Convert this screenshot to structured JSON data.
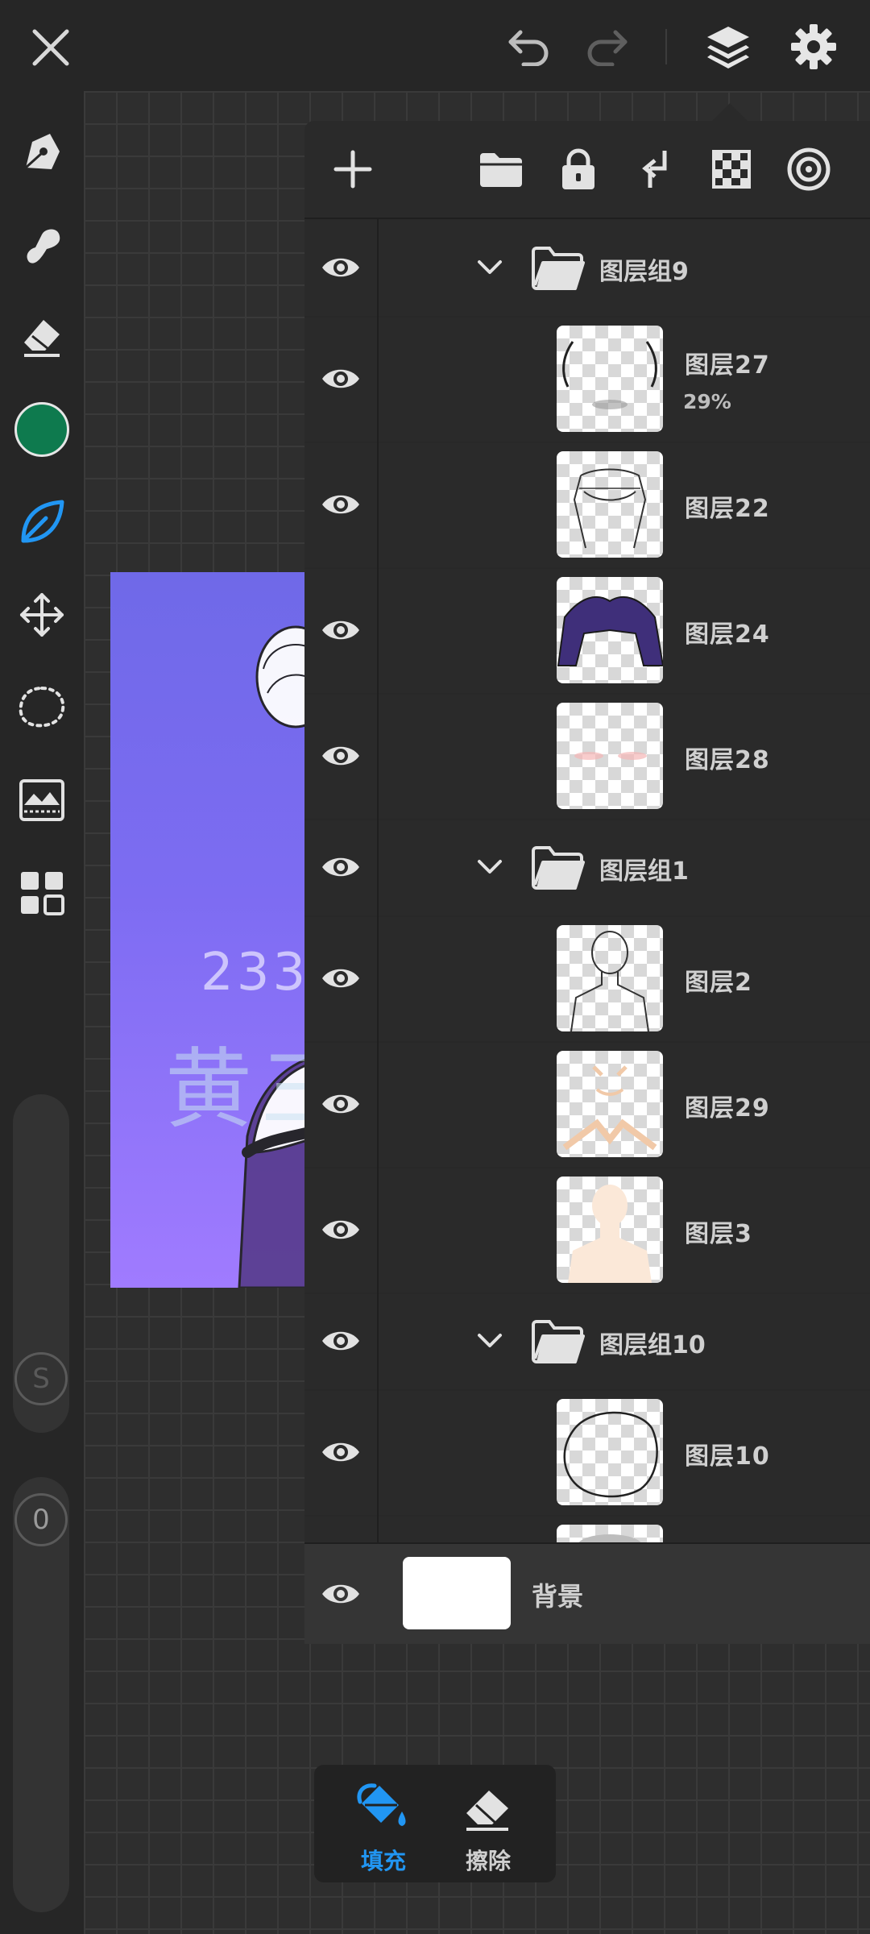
{
  "panel": {
    "layers": [
      {
        "kind": "group",
        "name": "图层组9"
      },
      {
        "kind": "layer",
        "name": "图层27",
        "opacity": "29%"
      },
      {
        "kind": "layer",
        "name": "图层22"
      },
      {
        "kind": "layer",
        "name": "图层24"
      },
      {
        "kind": "layer",
        "name": "图层28"
      },
      {
        "kind": "group",
        "name": "图层组1"
      },
      {
        "kind": "layer",
        "name": "图层2"
      },
      {
        "kind": "layer",
        "name": "图层29"
      },
      {
        "kind": "layer",
        "name": "图层3"
      },
      {
        "kind": "group",
        "name": "图层组10"
      },
      {
        "kind": "layer",
        "name": "图层10"
      }
    ],
    "background_label": "背景"
  },
  "artwork_text": {
    "line1": "233",
    "line2": "黄三"
  },
  "left_toolbar": {
    "s_badge": "S",
    "zero_badge": "0",
    "active_color": "#0e7a4e"
  },
  "bottom": {
    "fill_label": "填充",
    "erase_label": "擦除",
    "accent": "#2196f3"
  }
}
